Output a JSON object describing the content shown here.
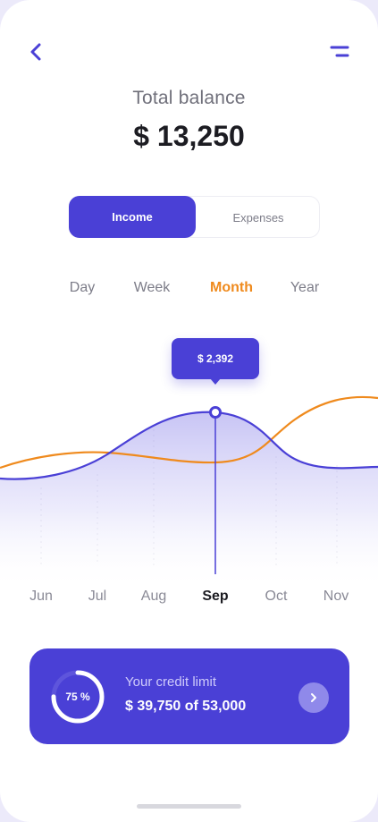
{
  "header": {
    "back_icon": "chevron-left-icon",
    "menu_icon": "menu-icon"
  },
  "balance": {
    "label": "Total balance",
    "value": "$ 13,250"
  },
  "toggle": {
    "income": "Income",
    "expenses": "Expenses",
    "selected": "Income"
  },
  "periods": {
    "day": "Day",
    "week": "Week",
    "month": "Month",
    "year": "Year",
    "selected": "Month"
  },
  "chart": {
    "tooltip": "$ 2,392",
    "months": [
      "Jun",
      "Jul",
      "Aug",
      "Sep",
      "Oct",
      "Nov"
    ],
    "selected_month": "Sep",
    "colors": {
      "income": "#4a40d6",
      "expenses": "#ef8a1d"
    }
  },
  "credit": {
    "percent_label": "75 %",
    "percent": 75,
    "title": "Your credit limit",
    "value": "$ 39,750 of 53,000"
  },
  "colors": {
    "accent": "#4a40d6",
    "orange": "#ef8a1d"
  }
}
